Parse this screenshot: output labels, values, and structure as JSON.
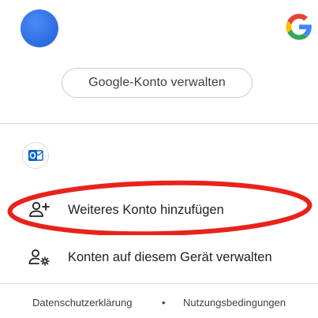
{
  "header": {
    "manage_account_label": "Google-Konto verwalten"
  },
  "icons": {
    "google": "google-g-logo",
    "outlook": "outlook-icon",
    "add_account": "person-add-icon",
    "manage_accounts": "person-settings-icon"
  },
  "menu": {
    "add_account_label": "Weiteres Konto hinzufügen",
    "manage_accounts_label": "Konten auf diesem Gerät verwalten"
  },
  "footer": {
    "privacy_label": "Datenschutzerklärung",
    "separator": "•",
    "terms_label": "Nutzungsbedingungen"
  },
  "colors": {
    "avatar": "#2f6fe4",
    "highlight": "#e8231c",
    "divider": "#dadce0",
    "outlook_blue": "#0a64c8"
  }
}
